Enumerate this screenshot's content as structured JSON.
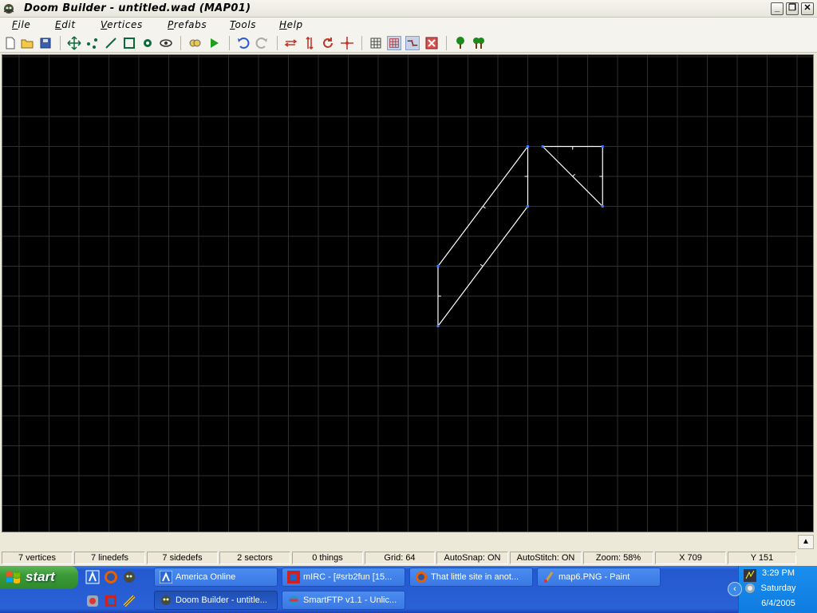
{
  "window": {
    "title": "Doom Builder - untitled.wad (MAP01)"
  },
  "menu": [
    {
      "hot": "F",
      "rest": "ile"
    },
    {
      "hot": "E",
      "rest": "dit"
    },
    {
      "hot": "V",
      "rest": "ertices"
    },
    {
      "hot": "P",
      "rest": "refabs"
    },
    {
      "hot": "T",
      "rest": "ools"
    },
    {
      "hot": "H",
      "rest": "elp"
    }
  ],
  "toolbar_icons": [
    "new-file-icon",
    "open-folder-icon",
    "save-icon",
    "move-mode-icon",
    "vertices-mode-icon",
    "linedefs-mode-icon",
    "sectors-mode-icon",
    "things-mode-icon",
    "3d-mode-icon",
    "find-icon",
    "test-map-icon",
    "undo-icon",
    "redo-icon",
    "flip-icon",
    "mirror-icon",
    "rotate-icon",
    "resize-icon",
    "grid-icon",
    "snap-grid-icon",
    "stitch-icon",
    "clear-icon",
    "node-builder-icon",
    "node-builder-alt-icon"
  ],
  "status": {
    "vertices": "7 vertices",
    "linedefs": "7 linedefs",
    "sidedefs": "7 sidedefs",
    "sectors": "2 sectors",
    "things": "0 things",
    "grid": "Grid: 64",
    "autosnap": "AutoSnap: ON",
    "autostitch": "AutoStitch: ON",
    "zoom": "Zoom: 58%",
    "x": "X 709",
    "y": "Y 151"
  },
  "map": {
    "vertices": [
      [
        0,
        0
      ],
      [
        0,
        -128
      ],
      [
        -192,
        -256
      ],
      [
        -192,
        -384
      ],
      [
        32,
        0
      ],
      [
        160,
        0
      ],
      [
        160,
        -128
      ]
    ],
    "linedefs": [
      [
        0,
        1
      ],
      [
        1,
        3
      ],
      [
        3,
        2
      ],
      [
        2,
        0
      ],
      [
        4,
        5
      ],
      [
        5,
        6
      ],
      [
        6,
        4
      ]
    ],
    "colors": {
      "background": "#000000",
      "grid": "#2f2f2f",
      "line": "#ffffff",
      "vertex": "#3a7bff"
    }
  },
  "taskbar": {
    "start": "start",
    "tasks_row1": [
      "America  Online",
      "mIRC - [#srb2fun [15...",
      "That little site in anot...",
      "map6.PNG - Paint"
    ],
    "tasks_row2": [
      "Doom Builder - untitle...",
      "SmartFTP v1.1 - Unlic..."
    ],
    "clock": {
      "time": "3:29 PM",
      "day": "Saturday",
      "date": "6/4/2005"
    }
  }
}
